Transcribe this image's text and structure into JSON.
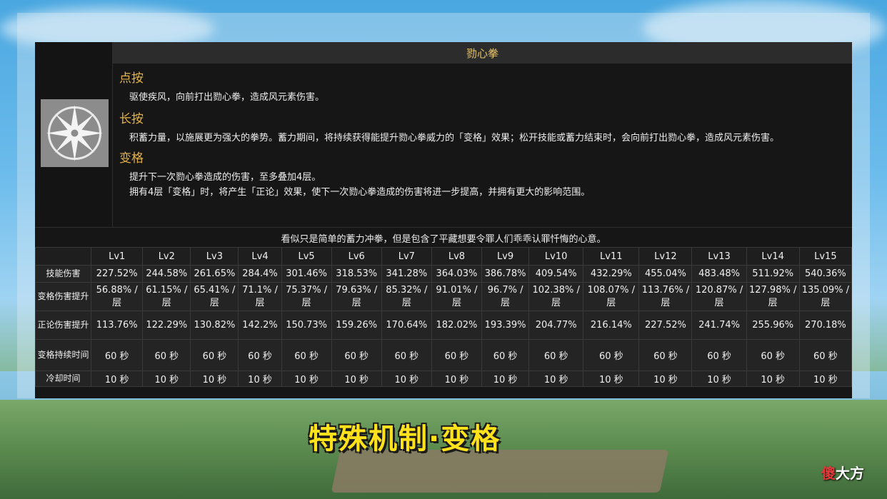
{
  "skill": {
    "title": "勠心拳",
    "sections": [
      {
        "heading": "点按",
        "lines": [
          "驱使疾风，向前打出勠心拳，造成风元素伤害。"
        ]
      },
      {
        "heading": "长按",
        "lines": [
          "积蓄力量，以施展更为强大的拳势。蓄力期间，将持续获得能提升勠心拳威力的「变格」效果；松开技能或蓄力结束时，会向前打出勠心拳，造成风元素伤害。"
        ]
      },
      {
        "heading": "变格",
        "lines": [
          "提升下一次勠心拳造成的伤害，至多叠加4层。",
          "拥有4层「变格」时，将产生「正论」效果，使下一次勠心拳造成的伤害将进一步提高，并拥有更大的影响范围。"
        ]
      }
    ],
    "flavor": "看似只是简单的蓄力冲拳，但是包含了平藏想要令罪人们乖乖认罪忏悔的心意。",
    "icon": "wind-star-icon"
  },
  "table": {
    "levels": [
      "Lv1",
      "Lv2",
      "Lv3",
      "Lv4",
      "Lv5",
      "Lv6",
      "Lv7",
      "Lv8",
      "Lv9",
      "Lv10",
      "Lv11",
      "Lv12",
      "Lv13",
      "Lv14",
      "Lv15"
    ],
    "rows": [
      {
        "label": "技能伤害",
        "values": [
          "227.52%",
          "244.58%",
          "261.65%",
          "284.4%",
          "301.46%",
          "318.53%",
          "341.28%",
          "364.03%",
          "386.78%",
          "409.54%",
          "432.29%",
          "455.04%",
          "483.48%",
          "511.92%",
          "540.36%"
        ]
      },
      {
        "label": "变格伤害提升",
        "values": [
          "56.88% / 层",
          "61.15% / 层",
          "65.41% / 层",
          "71.1% / 层",
          "75.37% / 层",
          "79.63% / 层",
          "85.32% / 层",
          "91.01% / 层",
          "96.7% / 层",
          "102.38% / 层",
          "108.07% / 层",
          "113.76% / 层",
          "120.87% / 层",
          "127.98% / 层",
          "135.09% / 层"
        ]
      },
      {
        "label": "正论伤害提升",
        "values": [
          "113.76%",
          "122.29%",
          "130.82%",
          "142.2%",
          "150.73%",
          "159.26%",
          "170.64%",
          "182.02%",
          "193.39%",
          "204.77%",
          "216.14%",
          "227.52%",
          "241.74%",
          "255.96%",
          "270.18%"
        ]
      },
      {
        "label": "变格持续时间",
        "values": [
          "60 秒",
          "60 秒",
          "60 秒",
          "60 秒",
          "60 秒",
          "60 秒",
          "60 秒",
          "60 秒",
          "60 秒",
          "60 秒",
          "60 秒",
          "60 秒",
          "60 秒",
          "60 秒",
          "60 秒"
        ]
      },
      {
        "label": "冷却时间",
        "values": [
          "10 秒",
          "10 秒",
          "10 秒",
          "10 秒",
          "10 秒",
          "10 秒",
          "10 秒",
          "10 秒",
          "10 秒",
          "10 秒",
          "10 秒",
          "10 秒",
          "10 秒",
          "10 秒",
          "10 秒"
        ]
      }
    ]
  },
  "caption": "特殊机制·变格",
  "watermark": {
    "first": "傻",
    "rest": "大方"
  }
}
